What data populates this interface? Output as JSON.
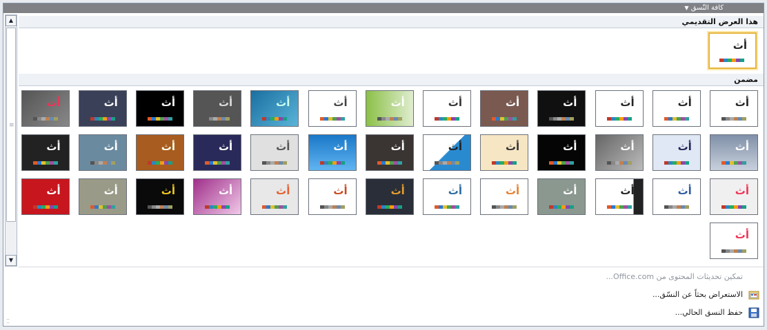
{
  "title": "كافة النّسق",
  "sections": {
    "current": "هذا العرض التقديمي",
    "builtin": "مضمن"
  },
  "thumb_label": "أث",
  "menu": {
    "enable_updates": "تمكين تحديثات المحتوى من Office.com...",
    "browse": "الاستعراض بحثاً عن النسّق...",
    "save": "حفظ النسق الحالي..."
  },
  "colors": {
    "titlebar": "#7f8185",
    "selection": "#e6b43c"
  }
}
